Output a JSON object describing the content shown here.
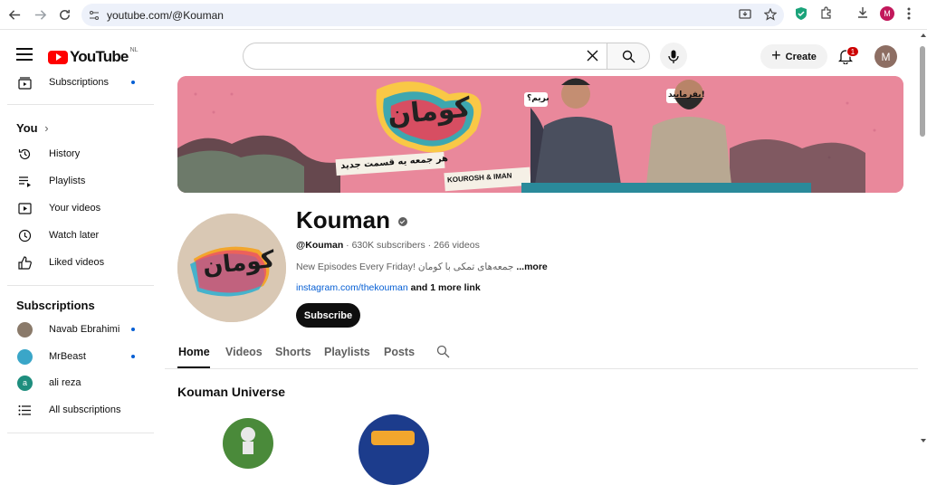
{
  "browser": {
    "url": "youtube.com/@Kouman",
    "profile_initial": "M"
  },
  "header": {
    "logo_text": "YouTube",
    "country_code": "NL",
    "search_value": "",
    "create_label": "Create",
    "notification_count": "1",
    "avatar_initial": "M"
  },
  "sidebar": {
    "top_items": [
      {
        "label": "Subscriptions",
        "icon": "subscriptions-icon"
      }
    ],
    "you_heading": "You",
    "you_items": [
      {
        "label": "History",
        "icon": "history-icon"
      },
      {
        "label": "Playlists",
        "icon": "playlists-icon"
      },
      {
        "label": "Your videos",
        "icon": "your-videos-icon"
      },
      {
        "label": "Watch later",
        "icon": "watch-later-icon"
      },
      {
        "label": "Liked videos",
        "icon": "liked-videos-icon"
      }
    ],
    "subs_heading": "Subscriptions",
    "subscriptions": [
      {
        "label": "Navab Ebrahimi",
        "color": "#8a7a6a"
      },
      {
        "label": "MrBeast",
        "color": "#3aa6c8"
      },
      {
        "label": "ali reza",
        "color": "#1e8e7e",
        "initial": "a"
      },
      {
        "label": "All subscriptions",
        "icon": "list-icon"
      }
    ]
  },
  "channel": {
    "name": "Kouman",
    "handle": "@Kouman",
    "stats": " · 630K subscribers · 266 videos",
    "description": "New Episodes Every Friday!  جمعه‌های تمکی با کومان ",
    "more": "...more",
    "link": "instagram.com/thekouman",
    "link_extra": " and 1 more link",
    "subscribe_label": "Subscribe",
    "banner_lines": {
      "logo": "کومان",
      "tagline": "هر جمعه یه قسمت جدید",
      "bubble1": "بریم؟",
      "bubble2": "بفرمایید!",
      "names": "KOUROSH & IMAN"
    },
    "avatar_text": "کومان"
  },
  "tabs": [
    {
      "label": "Home",
      "active": true
    },
    {
      "label": "Videos"
    },
    {
      "label": "Shorts"
    },
    {
      "label": "Playlists"
    },
    {
      "label": "Posts"
    }
  ],
  "section": {
    "title": "Kouman Universe"
  },
  "colors": {
    "brand_red": "#ff0000",
    "link_blue": "#065fd4",
    "banner_pink": "#e9889b"
  }
}
